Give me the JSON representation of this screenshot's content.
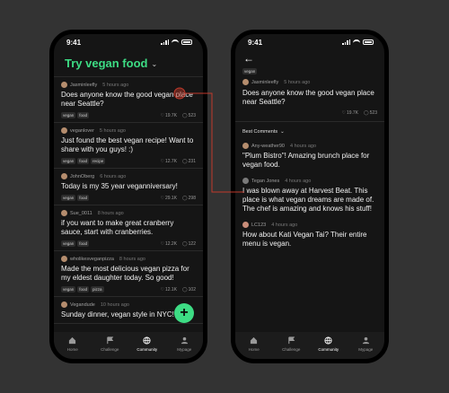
{
  "status_time": "9:41",
  "feed": {
    "title": "Try vegan food",
    "posts": [
      {
        "user": "Jasminleefly",
        "time": "5 hours ago",
        "text": "Does anyone know the good vegan place near Seattle?",
        "tags": [
          "vegan",
          "food"
        ],
        "likes": "19.7K",
        "comments": "523"
      },
      {
        "user": "veganlover",
        "time": "5 hours ago",
        "text": "Just found the best vegan recipe! Want to share with you guys! :)",
        "tags": [
          "vegan",
          "food",
          "recipe"
        ],
        "likes": "12.7K",
        "comments": "231"
      },
      {
        "user": "JohnOberg",
        "time": "6 hours ago",
        "text": "Today is my 35 year veganniversary!",
        "tags": [
          "vegan",
          "food"
        ],
        "likes": "29.1K",
        "comments": "298"
      },
      {
        "user": "Sue_0011",
        "time": "8 hours ago",
        "text": "if you want to make great cranberry sauce, start with cranberries.",
        "tags": [
          "vegan",
          "food"
        ],
        "likes": "12.2K",
        "comments": "122"
      },
      {
        "user": "wholikesveganpizza",
        "time": "8 hours ago",
        "text": "Made the most delicious vegan pizza for my eldest daughter today. So good!",
        "tags": [
          "vegan",
          "food",
          "pizza"
        ],
        "likes": "12.1K",
        "comments": "102"
      },
      {
        "user": "Vegandude",
        "time": "10 hours ago",
        "text": "Sunday dinner, vegan style in NYC!",
        "tags": [],
        "likes": "",
        "comments": ""
      }
    ]
  },
  "fab_label": "+",
  "tabs": [
    {
      "label": "Home",
      "icon": "home-icon"
    },
    {
      "label": "Challenge",
      "icon": "flag-icon"
    },
    {
      "label": "Community",
      "icon": "globe-icon"
    },
    {
      "label": "Mypage",
      "icon": "user-icon"
    }
  ],
  "detail": {
    "back_icon": "arrow-left-icon",
    "tag": "vegan",
    "post": {
      "user": "Jasminleefly",
      "time": "5 hours ago",
      "text": "Does anyone know the good vegan place near Seattle?",
      "likes": "19.7K",
      "comments": "523"
    },
    "sort_label": "Best Comments",
    "comments": [
      {
        "user": "Any-weather90",
        "time": "4 hours ago",
        "text": "\"Plum Bistro\"! Amazing brunch place for vegan food."
      },
      {
        "user": "Tegan Jones",
        "time": "4 hours ago",
        "text": "I was blown away at Harvest Beat. This place is what vegan dreams are made of. The chef is amazing and knows his stuff!"
      },
      {
        "user": "LC123",
        "time": "4 hours ago",
        "text": "How about Kati Vegan Tai? Their entire menu is vegan."
      }
    ]
  },
  "colors": {
    "accent": "#3ddc84",
    "connector": "#c0392b"
  }
}
